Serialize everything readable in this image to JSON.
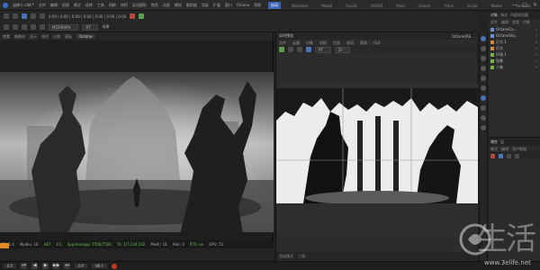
{
  "app": {
    "file_title": "吉祥人 c4d *",
    "menus": [
      "文件",
      "编辑",
      "创建",
      "模式",
      "选择",
      "工具",
      "网格",
      "体积",
      "运动图形",
      "角色",
      "动画",
      "模拟",
      "跟踪器",
      "渲染",
      "扩展",
      "窗口",
      "Octane",
      "帮助"
    ],
    "layout_tabs": [
      "启动",
      "Standard",
      "Model",
      "Sculpt",
      "UVEdit",
      "Paint",
      "Groom",
      "Track",
      "Script",
      "Nodes",
      "Animate"
    ],
    "active_layout_tab": "启动",
    "window_controls": [
      "—",
      "▢",
      "✕"
    ]
  },
  "toolbar": {
    "row1": "0:00 | 0:00 | 0:00 | 0:00 | 0:00 | 0:00 | 0:00",
    "mode_select": "MOGRAPH",
    "mode_select2": "RT",
    "scene_label": "场景"
  },
  "viewport": {
    "menu": [
      "查看",
      "摄像机",
      "显示",
      "选项",
      "过滤",
      "面板"
    ],
    "camera_tag": "Octane",
    "status_items": [
      "IRL 1.0",
      "Mydiio: 16",
      "447",
      "1/1",
      "Spp/maxspp: 7556/7500",
      "Tri: 3/7,134,102",
      "Mesh: 18",
      "Hair: 0",
      "RTX: on",
      "GPU: 51"
    ]
  },
  "octane": {
    "title": "实时预览",
    "badge": "Octane(RE...",
    "menu": [
      "文件",
      "云端",
      "对象",
      "材质",
      "比较",
      "选项",
      "帮助",
      "GUI"
    ],
    "mode_labels": [
      "PT",
      "ZI"
    ],
    "footer": [
      "渲染模式",
      "三维"
    ]
  },
  "objects": {
    "tabs": [
      "对象",
      "场次",
      "内容浏览器"
    ],
    "active_tab": "对象",
    "menu": [
      "文件",
      "编辑",
      "查看",
      "对象"
    ],
    "items": [
      {
        "name": "OctaneCa...",
        "icon": "camera-icon",
        "color": "b"
      },
      {
        "name": "OctaneSky...",
        "icon": "sky-icon",
        "color": "b"
      },
      {
        "name": "灯光.1",
        "icon": "light-icon",
        "color": "o"
      },
      {
        "name": "灯光",
        "icon": "light-icon",
        "color": "o"
      },
      {
        "name": "环境.1",
        "icon": "environment-icon",
        "color": "g"
      },
      {
        "name": "场景",
        "icon": "null-icon",
        "color": "g"
      },
      {
        "name": "人物",
        "icon": "null-icon",
        "color": "g"
      }
    ]
  },
  "attributes": {
    "tabs": [
      "属性",
      "层"
    ],
    "active_tab": "属性",
    "menu": [
      "模式",
      "编辑",
      "用户数据"
    ]
  },
  "timeline": {
    "frame_start": "0 F",
    "frame_current": "0 F",
    "frame_end": "90 F",
    "controls": [
      "⏮",
      "◀",
      "▶",
      "▶▶",
      "⏭"
    ]
  },
  "watermark": {
    "text": "生活",
    "url": "www.3elife.net"
  },
  "colors": {
    "accent": "#3f67b5",
    "status_green": "#6cbf4a",
    "orange": "#e08a2a"
  }
}
